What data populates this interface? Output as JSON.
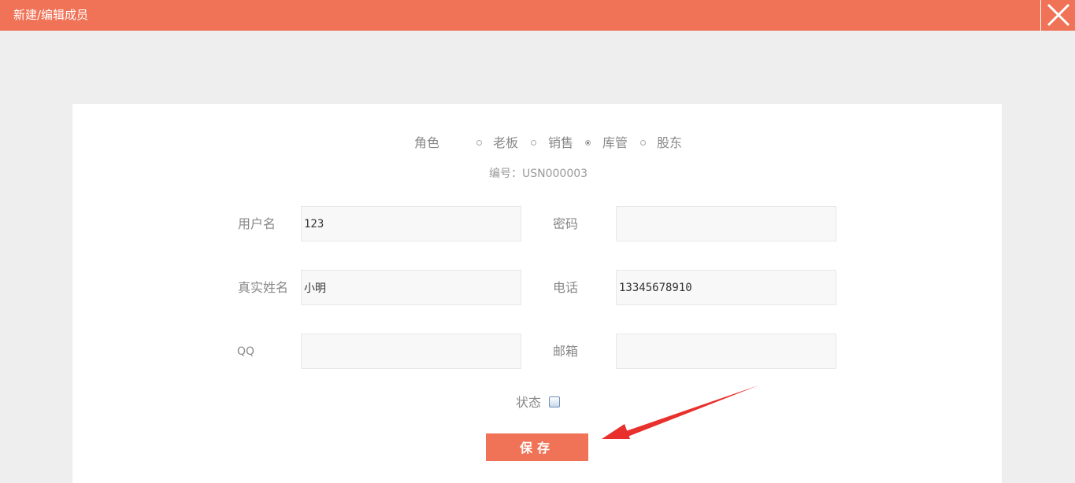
{
  "titlebar": {
    "title": "新建/编辑成员",
    "close_icon": "close-icon"
  },
  "form": {
    "role_label": "角色",
    "roles": [
      {
        "label": "老板",
        "checked": false
      },
      {
        "label": "销售",
        "checked": false
      },
      {
        "label": "库管",
        "checked": true
      },
      {
        "label": "股东",
        "checked": false
      }
    ],
    "code_text": "编号：USN000003",
    "username_label": "用户名",
    "username_value": "123",
    "password_label": "密码",
    "password_value": "",
    "realname_label": "真实姓名",
    "realname_value": "小明",
    "phone_label": "电话",
    "phone_value": "13345678910",
    "qq_label": "QQ",
    "qq_value": "",
    "email_label": "邮箱",
    "email_value": "",
    "status_label": "状态",
    "status_checked": false,
    "save_label": "保存"
  },
  "colors": {
    "accent": "#f07357",
    "background": "#eeeeee",
    "panel": "#ffffff",
    "annotation_arrow": "#e8302c"
  }
}
